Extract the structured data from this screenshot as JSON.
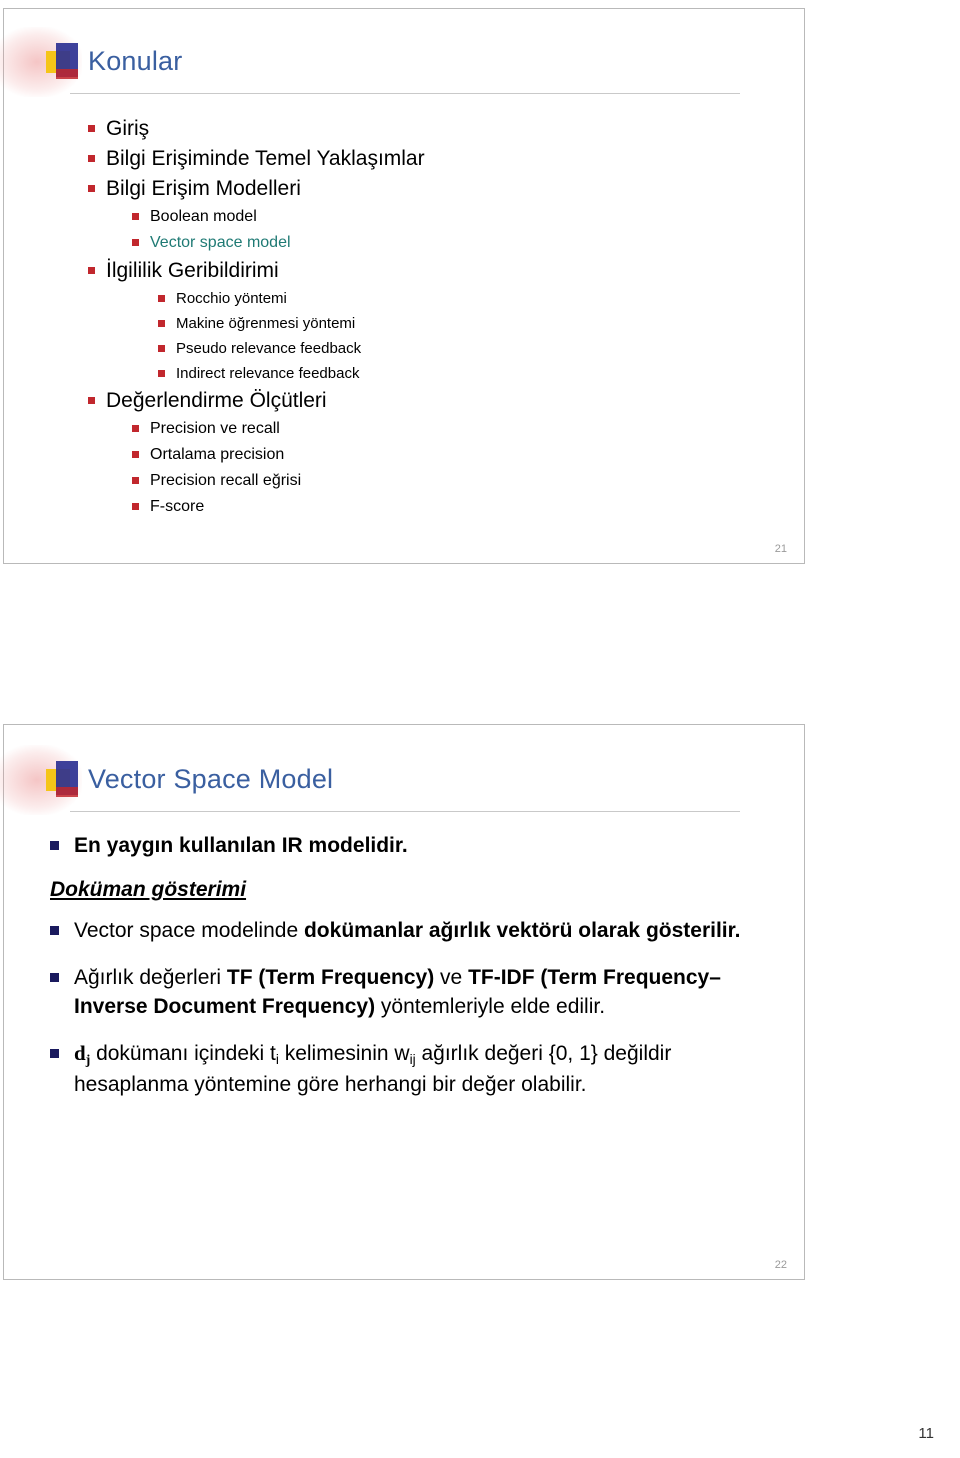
{
  "page": {
    "page_number": "11"
  },
  "slide1": {
    "title": "Konular",
    "slide_number": "21",
    "items": [
      {
        "text": "Giriş",
        "level": 1,
        "color": "default"
      },
      {
        "text": "Bilgi Erişiminde Temel Yaklaşımlar",
        "level": 1,
        "color": "default"
      },
      {
        "text": "Bilgi Erişim Modelleri",
        "level": 1,
        "color": "default"
      },
      {
        "text": "Boolean model",
        "level": 2,
        "color": "default"
      },
      {
        "text": "Vector space model",
        "level": 2,
        "color": "teal"
      },
      {
        "text": "İlgililik Geribildirimi",
        "level": 1,
        "color": "default"
      },
      {
        "text": "Rocchio yöntemi",
        "level": 3,
        "color": "default"
      },
      {
        "text": "Makine öğrenmesi yöntemi",
        "level": 3,
        "color": "default"
      },
      {
        "text": "Pseudo relevance feedback",
        "level": 3,
        "color": "default"
      },
      {
        "text": "Indirect relevance feedback",
        "level": 3,
        "color": "default"
      },
      {
        "text": "Değerlendirme Ölçütleri",
        "level": 1,
        "color": "default"
      },
      {
        "text": "Precision ve recall",
        "level": 2,
        "color": "default"
      },
      {
        "text": "Ortalama precision",
        "level": 2,
        "color": "default"
      },
      {
        "text": "Precision recall eğrisi",
        "level": 2,
        "color": "default"
      },
      {
        "text": "F-score",
        "level": 2,
        "color": "default"
      }
    ]
  },
  "slide2": {
    "title": "Vector Space Model",
    "slide_number": "22",
    "bullet1": "En yaygın kullanılan IR modelidir.",
    "subheading": "Doküman gösterimi",
    "bullet2_part1": "Vector space modelinde ",
    "bullet2_bold": "dokümanlar ağırlık vektörü olarak gösterilir.",
    "bullet3_part1": "Ağırlık değerleri ",
    "bullet3_bold1": "TF (Term Frequency)",
    "bullet3_part2": " ve ",
    "bullet3_bold2": "TF-IDF (Term Frequency–Inverse Document Frequency)",
    "bullet3_part3": " yöntemleriyle elde edilir.",
    "bullet4_d": "d",
    "bullet4_dsub": "j",
    "bullet4_p1": " dokümanı içindeki t",
    "bullet4_tsub": "i",
    "bullet4_p2": " kelimesinin w",
    "bullet4_wsub": "ij",
    "bullet4_p3": " ağırlık değeri {0, 1} değildir hesaplanma yöntemine göre herhangi bir değer olabilir."
  },
  "colors": {
    "title_blue": "#3a5fa0",
    "bullet_red": "#c1272d",
    "bullet_navy": "#1a1a5e",
    "teal": "#1f7a74"
  }
}
